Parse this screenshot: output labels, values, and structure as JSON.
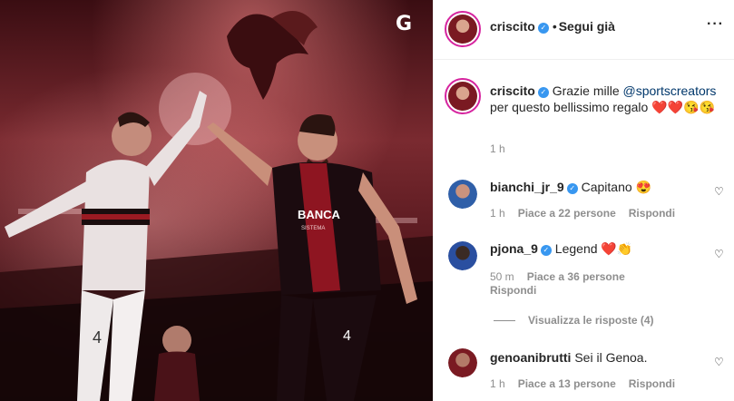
{
  "post": {
    "brand_mark": "G",
    "jersey_sponsor": "BANCA",
    "jersey_sponsor_sub": "SISTEMA",
    "number_left": "4",
    "number_right": "4"
  },
  "header": {
    "username": "criscito",
    "verified_icon": "verified-badge",
    "separator": "•",
    "follow_label": "Segui già",
    "more_icon": "more-horizontal-icon"
  },
  "caption": {
    "username": "criscito",
    "text_before": "Grazie mille",
    "mention": "@sportscreators",
    "text_after": "per questo bellissimo regalo ❤️❤️😘😘",
    "time": "1 h"
  },
  "comments": [
    {
      "username": "bianchi_jr_9",
      "verified": true,
      "text": "Capitano 😍",
      "time": "1 h",
      "likes": "Piace a 22 persone",
      "reply": "Rispondi"
    },
    {
      "username": "pjona_9",
      "verified": true,
      "text": "Legend ❤️👏",
      "time": "50 m",
      "likes": "Piace a 36 persone",
      "reply": "Rispondi",
      "view_replies": "Visualizza le risposte (4)"
    },
    {
      "username": "genoanibrutti",
      "verified": false,
      "text": "Sei il Genoa.",
      "time": "1 h",
      "likes": "Piace a 13 persone",
      "reply": "Rispondi"
    }
  ],
  "colors": {
    "accent_link": "#00376b",
    "verified": "#3897f0",
    "meta": "#8e8e8e",
    "story_ring": "#d6249f"
  }
}
